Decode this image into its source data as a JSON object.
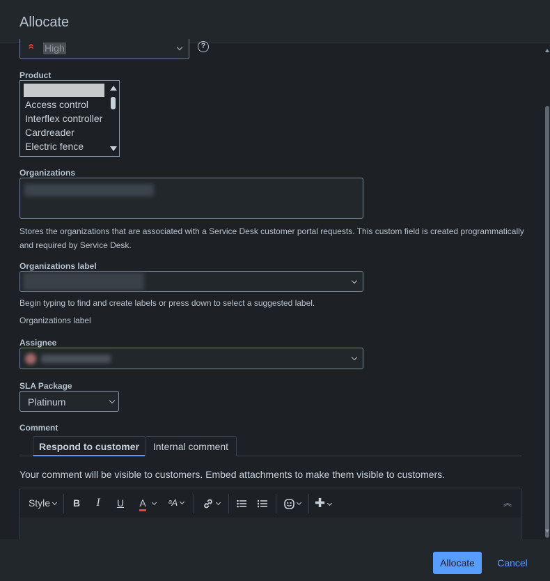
{
  "dialog": {
    "title": "Allocate"
  },
  "priority": {
    "value": "High"
  },
  "product": {
    "label": "Product",
    "selected": "None",
    "options": [
      "Access control",
      "Interflex controller",
      "Cardreader",
      "Electric fence"
    ]
  },
  "organizations": {
    "label": "Organizations",
    "help": "Stores the organizations that are associated with a Service Desk customer portal requests. This custom field is created programmatically and required by Service Desk."
  },
  "organizations_label": {
    "label": "Organizations label",
    "help1": "Begin typing to find and create labels or press down to select a suggested label.",
    "help2": "Organizations label"
  },
  "assignee": {
    "label": "Assignee"
  },
  "sla": {
    "label": "SLA Package",
    "value": "Platinum"
  },
  "comment": {
    "label": "Comment",
    "tabs": [
      "Respond to customer",
      "Internal comment"
    ],
    "note": "Your comment will be visible to customers. Embed attachments to make them visible to customers."
  },
  "toolbar": {
    "style": "Style",
    "bold": "B",
    "italic": "I",
    "underline": "U",
    "text_color": "A",
    "more_format": "ᵃA"
  },
  "footer": {
    "primary": "Allocate",
    "cancel": "Cancel"
  },
  "colors": {
    "accent": "#579dff",
    "background": "#1d2125",
    "priority_high": "#e5493a"
  }
}
